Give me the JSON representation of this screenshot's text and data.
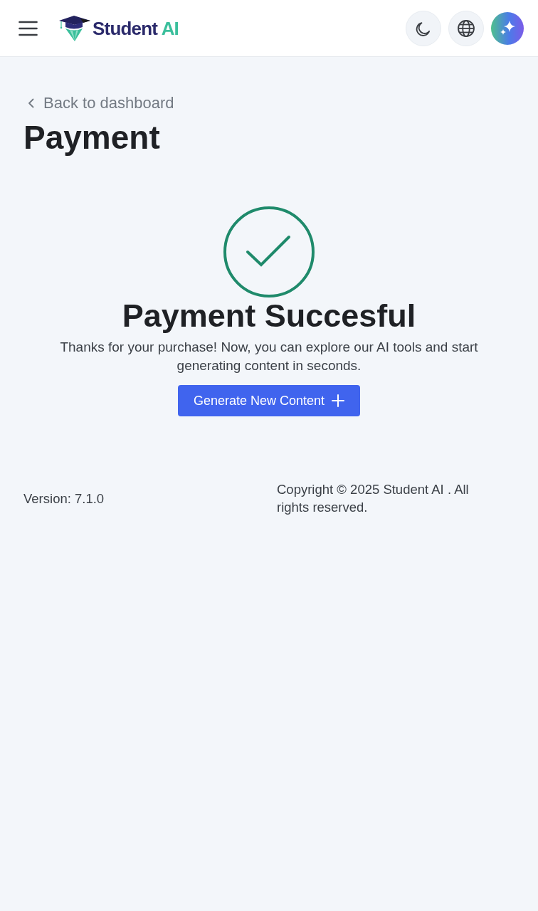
{
  "navbar": {
    "logo": {
      "name": "Student",
      "suffix": "AI"
    }
  },
  "back_link": {
    "label": "Back to dashboard"
  },
  "page_title": "Payment",
  "result": {
    "succeeded": true,
    "heading": "Payment Succesful",
    "message": "Thanks for your purchase! Now, you can explore our AI tools and start generating content in seconds.",
    "button": {
      "label": "Generate New Content"
    }
  },
  "footer": {
    "version": "Version: 7.1.0",
    "copyright": "Copyright © 2025 Student AI . All rights reserved."
  }
}
